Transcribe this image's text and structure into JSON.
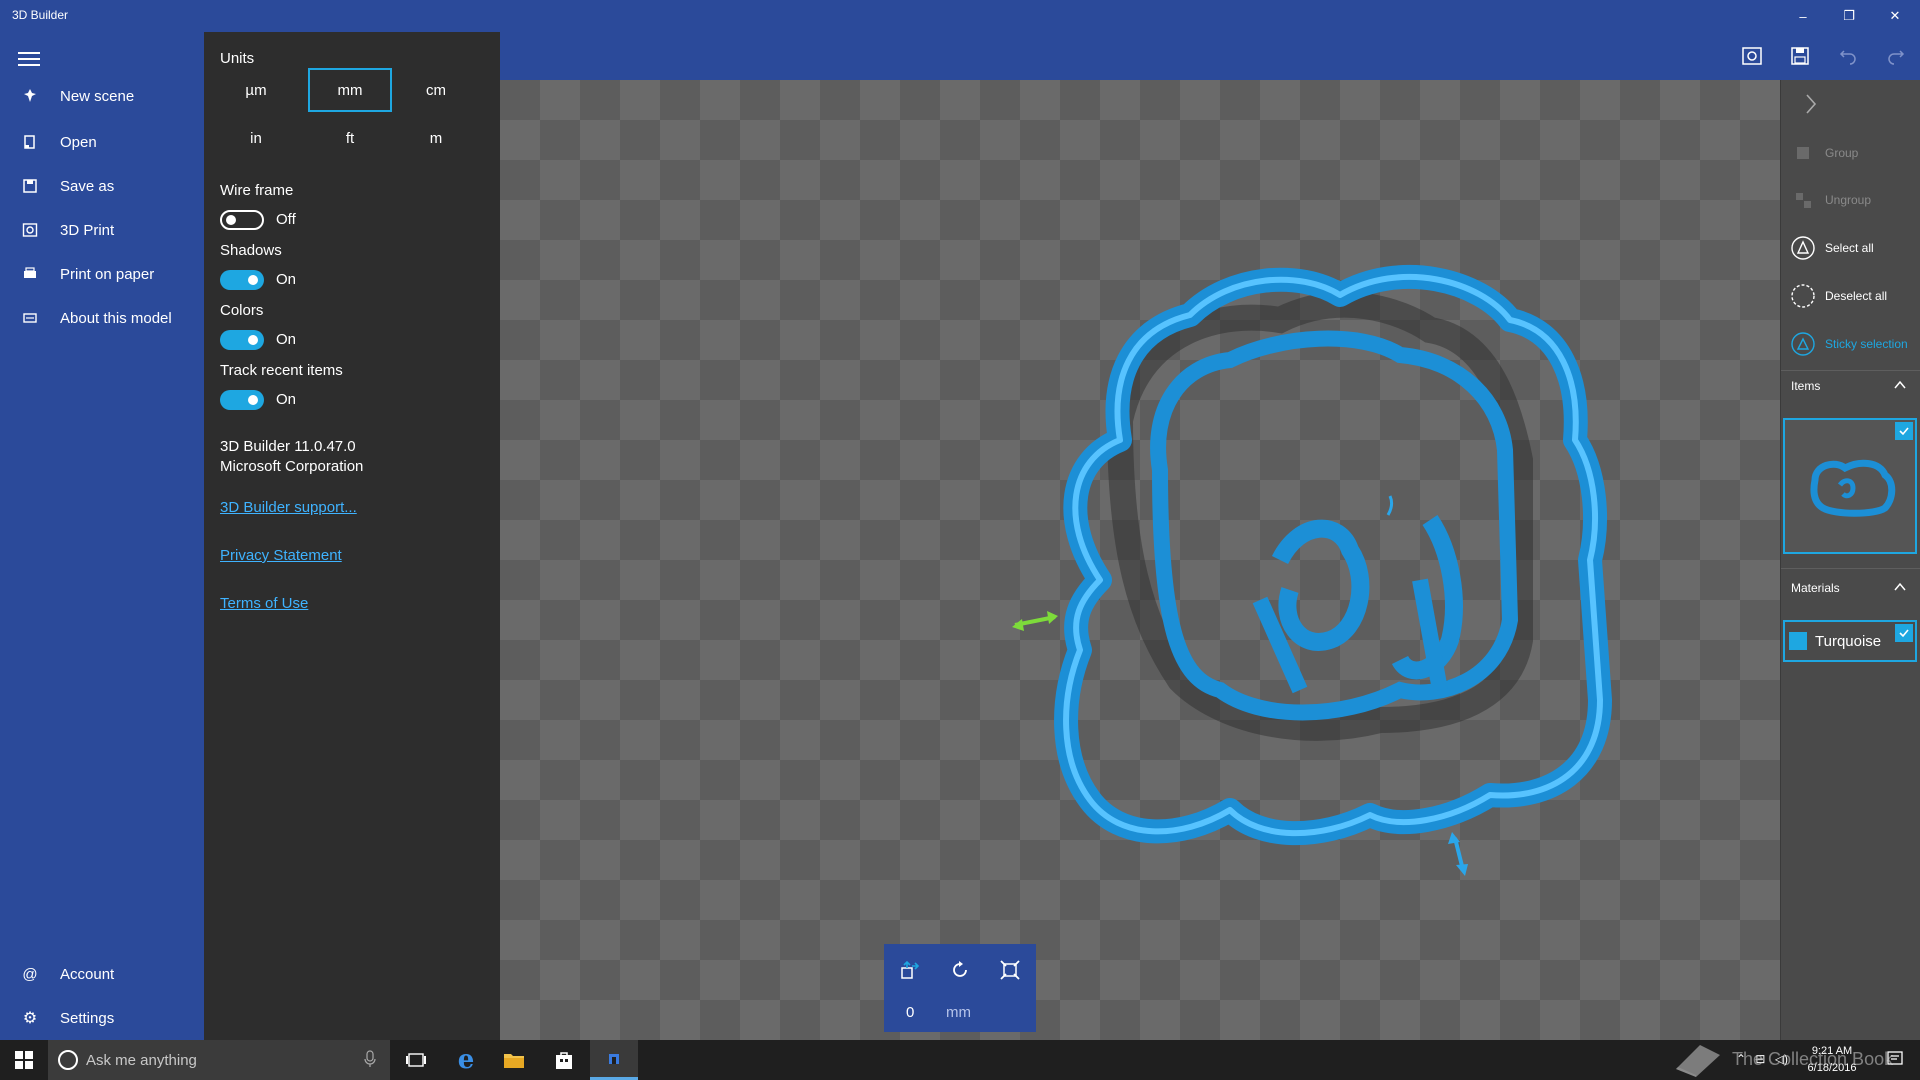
{
  "window": {
    "title": "3D Builder",
    "minimize": "–",
    "restore": "❐",
    "close": "✕"
  },
  "nav": {
    "items": [
      {
        "label": "New scene",
        "icon": "new-scene-icon"
      },
      {
        "label": "Open",
        "icon": "open-icon"
      },
      {
        "label": "Save as",
        "icon": "save-as-icon"
      },
      {
        "label": "3D Print",
        "icon": "3d-print-icon"
      },
      {
        "label": "Print on paper",
        "icon": "print-paper-icon"
      },
      {
        "label": "About this model",
        "icon": "about-model-icon"
      }
    ],
    "account_label": "Account",
    "settings_label": "Settings"
  },
  "settings": {
    "units_label": "Units",
    "units": [
      "µm",
      "mm",
      "cm",
      "in",
      "ft",
      "m"
    ],
    "selected_unit": "mm",
    "wireframe_label": "Wire frame",
    "wireframe_state": "Off",
    "shadows_label": "Shadows",
    "shadows_state": "On",
    "colors_label": "Colors",
    "colors_state": "On",
    "track_label": "Track recent items",
    "track_state": "On",
    "version": "3D Builder 11.0.47.0",
    "company": "Microsoft Corporation",
    "support_link": "3D Builder support...",
    "privacy_link": "Privacy Statement",
    "terms_link": "Terms of Use"
  },
  "tools": {
    "value": "0",
    "unit": "mm"
  },
  "rightpanel": {
    "group": "Group",
    "ungroup": "Ungroup",
    "select_all": "Select all",
    "deselect_all": "Deselect all",
    "sticky": "Sticky selection",
    "items_label": "Items",
    "materials_label": "Materials",
    "material_name": "Turquoise"
  },
  "taskbar": {
    "search_placeholder": "Ask me anything",
    "time": "9:21 AM",
    "date": "6/18/2016"
  },
  "watermark": "The Collection Book",
  "colors": {
    "accent": "#1ea7e1",
    "brand_blue": "#2b4a9a",
    "model": "#1c8fd6",
    "panel_dark": "#2d2d2d"
  }
}
